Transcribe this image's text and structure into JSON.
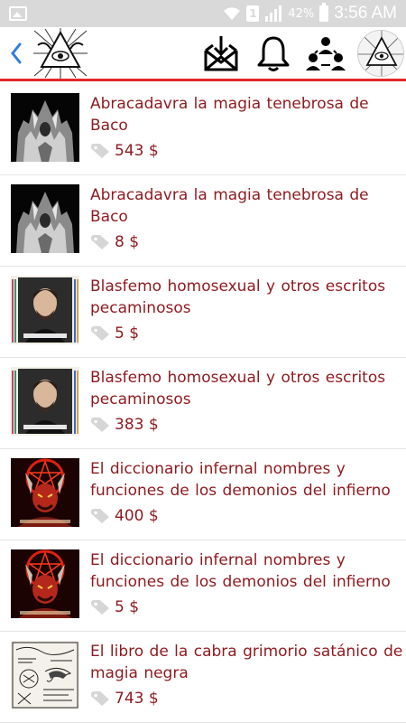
{
  "status_bar": {
    "sim_slot": "1",
    "battery_percent": "42%",
    "time": "3:56 AM"
  },
  "app_bar": {
    "back_icon": "chevron-left-icon",
    "logo_icon": "occult-emblem-logo",
    "actions": [
      "envelope-download-icon",
      "bell-icon",
      "group-users-icon",
      "profile-avatar"
    ]
  },
  "colors": {
    "accent": "#e3262c",
    "text": "#8e1a1f",
    "status_bar": "#d9d9d9"
  },
  "products": [
    {
      "title": "Abracadavra la magia tenebrosa de Baco",
      "price": "543 $",
      "thumb": "dark-statue"
    },
    {
      "title": "Abracadavra la magia tenebrosa de Baco",
      "price": "8 $",
      "thumb": "dark-statue"
    },
    {
      "title": "Blasfemo homosexual y otros escritos pecaminosos",
      "price": "5 $",
      "thumb": "portrait"
    },
    {
      "title": "Blasfemo homosexual y otros escritos pecaminosos",
      "price": "383 $",
      "thumb": "portrait"
    },
    {
      "title": "El diccionario infernal nombres y funciones de los demonios del infierno",
      "price": "400 $",
      "thumb": "demon"
    },
    {
      "title": "El diccionario infernal nombres y funciones de los demonios del infierno",
      "price": "5 $",
      "thumb": "demon"
    },
    {
      "title": "El libro de la cabra  grimorio satánico de magia negra",
      "price": "743 $",
      "thumb": "engraving"
    }
  ]
}
